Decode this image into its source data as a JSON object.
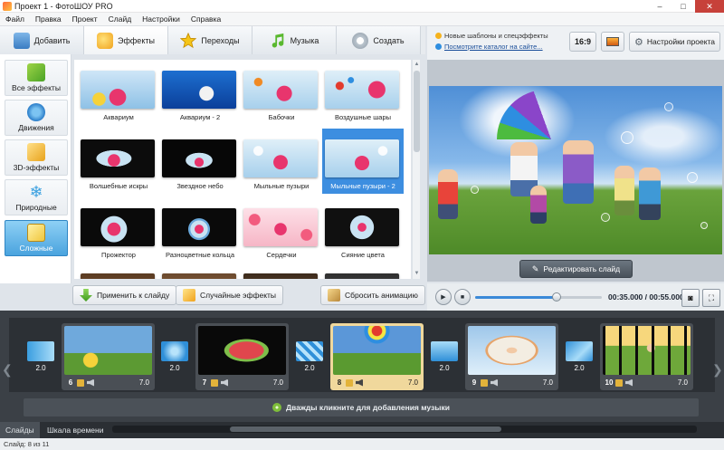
{
  "window": {
    "title": "Проект 1 - ФотоШОУ PRO",
    "minimize": "–",
    "maximize": "□",
    "close": "✕"
  },
  "menu": [
    "Файл",
    "Правка",
    "Проект",
    "Слайд",
    "Настройки",
    "Справка"
  ],
  "tabs": [
    {
      "label": "Добавить",
      "icon": "add-photo-icon"
    },
    {
      "label": "Эффекты",
      "icon": "effects-icon",
      "active": true
    },
    {
      "label": "Переходы",
      "icon": "star-icon"
    },
    {
      "label": "Музыка",
      "icon": "music-note-icon"
    },
    {
      "label": "Создать",
      "icon": "film-reel-icon"
    }
  ],
  "categories": [
    {
      "label": "Все эффекты",
      "icon": "puzzle-icon"
    },
    {
      "label": "Движения",
      "icon": "arrows-icon"
    },
    {
      "label": "3D-эффекты",
      "icon": "cube-icon"
    },
    {
      "label": "Природные",
      "icon": "snowflake-icon"
    },
    {
      "label": "Сложные",
      "icon": "layers-icon",
      "active": true
    }
  ],
  "effects": [
    {
      "label": "Аквариум"
    },
    {
      "label": "Аквариум - 2"
    },
    {
      "label": "Бабочки"
    },
    {
      "label": "Воздушные шары"
    },
    {
      "label": "Волшебные искры"
    },
    {
      "label": "Звездное небо"
    },
    {
      "label": "Мыльные пузыри"
    },
    {
      "label": "Мыльные пузыри - 2",
      "selected": true
    },
    {
      "label": "Прожектор"
    },
    {
      "label": "Разноцветные кольца"
    },
    {
      "label": "Сердечки"
    },
    {
      "label": "Сияние цвета"
    }
  ],
  "fx_buttons": {
    "apply": "Применить к слайду",
    "random": "Случайные эффекты",
    "reset": "Сбросить анимацию"
  },
  "news": {
    "line1": "Новые шаблоны и спецэффекты",
    "line2": "Посмотрите каталог на сайте..."
  },
  "toolbar": {
    "ratio": "16:9",
    "project_settings": "Настройки проекта"
  },
  "preview": {
    "edit_button": "Редактировать слайд"
  },
  "player": {
    "time": "00:35.000 / 00:55.000",
    "progress": 0.64
  },
  "slides": [
    {
      "num": "6",
      "duration": "7.0",
      "scene": "field"
    },
    {
      "num": "7",
      "duration": "7.0",
      "scene": "watermelon"
    },
    {
      "num": "8",
      "duration": "7.0",
      "scene": "kite",
      "selected": true
    },
    {
      "num": "9",
      "duration": "7.0",
      "scene": "dance"
    },
    {
      "num": "10",
      "duration": "7.0",
      "scene": "filmstrip"
    }
  ],
  "transitions": [
    {
      "duration": "2.0"
    },
    {
      "duration": "2.0"
    },
    {
      "duration": "2.0"
    },
    {
      "duration": "2.0"
    },
    {
      "duration": "2.0"
    }
  ],
  "music_hint": "Дважды кликните для добавления музыки",
  "bottom_tabs": {
    "slides": "Слайды",
    "timeline": "Шкала времени"
  },
  "status": "Слайд: 8 из 11",
  "colors": {
    "accent": "#3d8ee0",
    "selected_slide": "#f0d89c",
    "timeline_bg": "#3b4046"
  }
}
